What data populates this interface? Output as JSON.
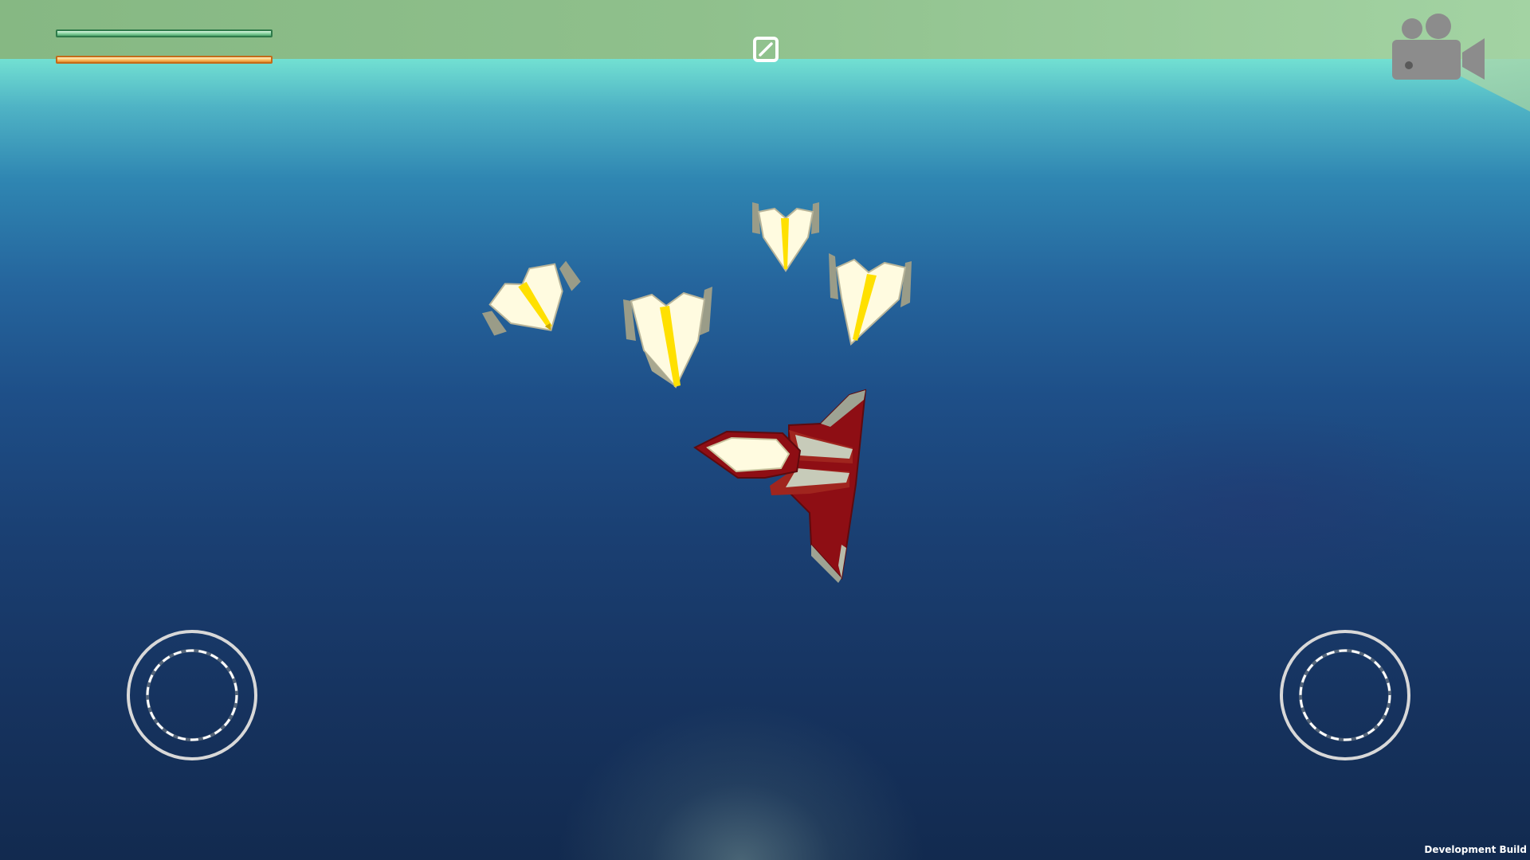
{
  "hud": {
    "health_level": 1.0,
    "energy_level": 1.0,
    "health_color": "#8ed6a4",
    "energy_color": "#ffc46a",
    "pause_icon": "pause-square-slash-icon",
    "camera_icon": "video-camera-icon"
  },
  "controls": {
    "left_joystick_icon": "joystick-ring",
    "right_joystick_icon": "joystick-ring"
  },
  "scene": {
    "player_ship_color": "#8e0e14",
    "enemy_ship_color": "#fffbe0",
    "enemy_stripe_color": "#ffe000",
    "enemy_count": 4
  },
  "footer": {
    "build_label": "Development Build"
  }
}
